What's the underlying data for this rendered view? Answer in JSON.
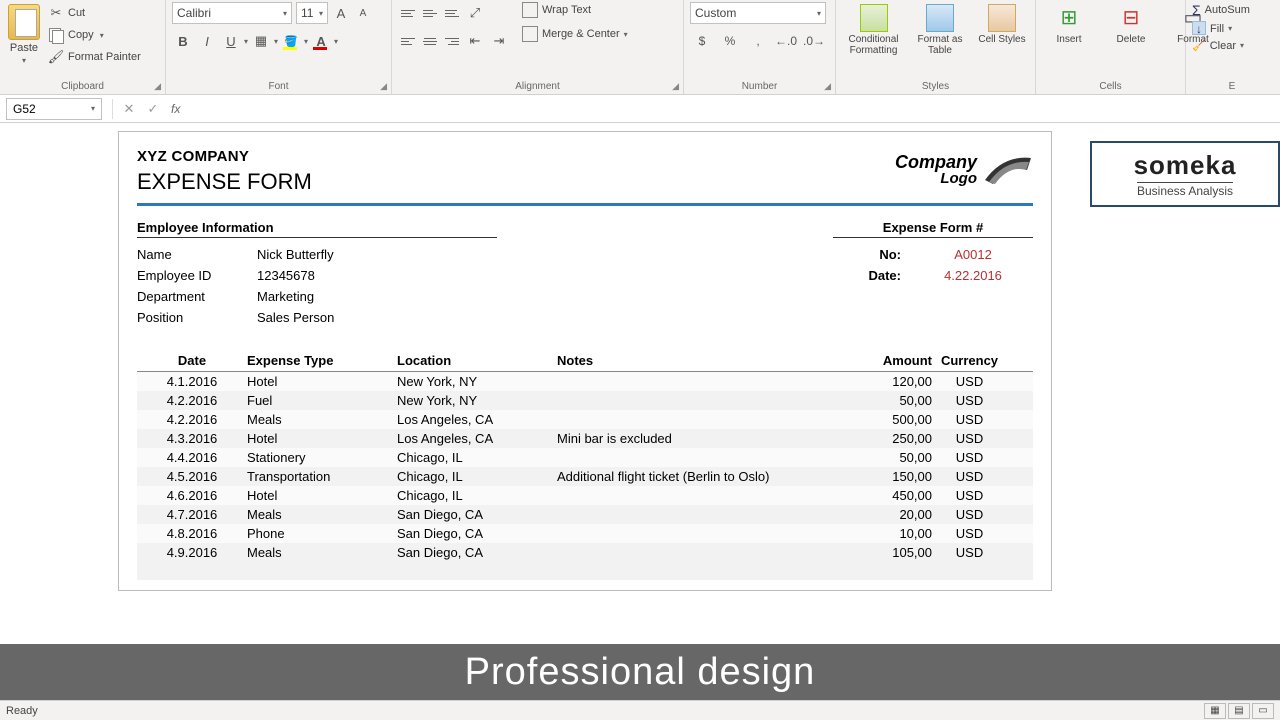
{
  "ribbon": {
    "clipboard": {
      "label": "Clipboard",
      "paste": "Paste",
      "cut": "Cut",
      "copy": "Copy",
      "formatPainter": "Format Painter"
    },
    "font": {
      "label": "Font",
      "name": "Calibri",
      "size": "11",
      "grow": "A",
      "shrink": "A",
      "bold": "B",
      "italic": "I",
      "underline": "U"
    },
    "alignment": {
      "label": "Alignment",
      "wrap": "Wrap Text",
      "merge": "Merge & Center"
    },
    "number": {
      "label": "Number",
      "format": "Custom",
      "currency": "$",
      "percent": "%",
      "comma": ",",
      "inc": ".00",
      "dec": ".0"
    },
    "styles": {
      "label": "Styles",
      "cond": "Conditional Formatting",
      "table": "Format as Table",
      "cell": "Cell Styles"
    },
    "cells": {
      "label": "Cells",
      "insert": "Insert",
      "delete": "Delete",
      "format": "Format"
    },
    "editing": {
      "label": "E",
      "autosum": "AutoSum",
      "fill": "Fill",
      "clear": "Clear"
    }
  },
  "formulaBar": {
    "cellRef": "G52",
    "cancel": "✕",
    "confirm": "✓",
    "fx": "fx",
    "value": ""
  },
  "doc": {
    "company": "XYZ COMPANY",
    "title": "EXPENSE FORM",
    "logoTop": "Company",
    "logoBottom": "Logo",
    "empSection": "Employee Information",
    "formSection": "Expense Form #",
    "emp": {
      "nameLabel": "Name",
      "name": "Nick Butterfly",
      "idLabel": "Employee ID",
      "id": "12345678",
      "deptLabel": "Department",
      "dept": "Marketing",
      "posLabel": "Position",
      "pos": "Sales Person"
    },
    "formInfo": {
      "noLabel": "No:",
      "no": "A0012",
      "dateLabel": "Date:",
      "date": "4.22.2016"
    },
    "headers": {
      "date": "Date",
      "type": "Expense Type",
      "loc": "Location",
      "notes": "Notes",
      "amount": "Amount",
      "currency": "Currency"
    },
    "rows": [
      {
        "date": "4.1.2016",
        "type": "Hotel",
        "loc": "New York, NY",
        "notes": "",
        "amount": "120,00",
        "currency": "USD"
      },
      {
        "date": "4.2.2016",
        "type": "Fuel",
        "loc": "New York, NY",
        "notes": "",
        "amount": "50,00",
        "currency": "USD"
      },
      {
        "date": "4.2.2016",
        "type": "Meals",
        "loc": "Los Angeles, CA",
        "notes": "",
        "amount": "500,00",
        "currency": "USD"
      },
      {
        "date": "4.3.2016",
        "type": "Hotel",
        "loc": "Los Angeles, CA",
        "notes": "Mini bar is excluded",
        "amount": "250,00",
        "currency": "USD"
      },
      {
        "date": "4.4.2016",
        "type": "Stationery",
        "loc": "Chicago, IL",
        "notes": "",
        "amount": "50,00",
        "currency": "USD"
      },
      {
        "date": "4.5.2016",
        "type": "Transportation",
        "loc": "Chicago, IL",
        "notes": "Additional flight ticket (Berlin to Oslo)",
        "amount": "150,00",
        "currency": "USD"
      },
      {
        "date": "4.6.2016",
        "type": "Hotel",
        "loc": "Chicago, IL",
        "notes": "",
        "amount": "450,00",
        "currency": "USD"
      },
      {
        "date": "4.7.2016",
        "type": "Meals",
        "loc": "San Diego, CA",
        "notes": "",
        "amount": "20,00",
        "currency": "USD"
      },
      {
        "date": "4.8.2016",
        "type": "Phone",
        "loc": "San Diego, CA",
        "notes": "",
        "amount": "10,00",
        "currency": "USD"
      },
      {
        "date": "4.9.2016",
        "type": "Meals",
        "loc": "San Diego, CA",
        "notes": "",
        "amount": "105,00",
        "currency": "USD"
      }
    ]
  },
  "someka": {
    "name": "someka",
    "tagline": "Business Analysis"
  },
  "banner": "Professional design",
  "status": {
    "ready": "Ready"
  }
}
